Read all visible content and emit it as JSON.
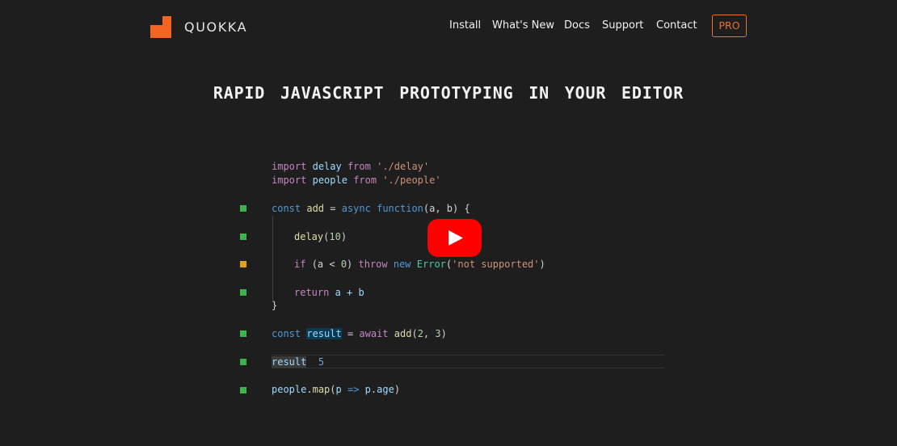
{
  "brand": {
    "name": "QUOKKA",
    "accent_color": "#f26522"
  },
  "nav": {
    "items": [
      {
        "label": "Install"
      },
      {
        "label": "What's New"
      },
      {
        "label": "Docs"
      },
      {
        "label": "Support"
      },
      {
        "label": "Contact"
      }
    ],
    "pro_label": "PRO",
    "pro_color": "#e8742a"
  },
  "hero": {
    "headline": "RAPID JAVASCRIPT PROTOTYPING IN YOUR EDITOR"
  },
  "code": {
    "line1": {
      "kw_import": "import",
      "name": "delay",
      "kw_from": "from",
      "path": "'./delay'"
    },
    "line2": {
      "kw_import": "import",
      "name": "people",
      "kw_from": "from",
      "path": "'./people'"
    },
    "line3": {
      "kw_const": "const",
      "name": "add",
      "eq": " = ",
      "kw_async": "async",
      "kw_function": "function",
      "params": "(a, b) {"
    },
    "line4": {
      "fn": "delay",
      "open": "(",
      "num": "10",
      "close": ")"
    },
    "line5": {
      "kw_if": "if",
      "cond": "(a < ",
      "num": "0",
      "close": ") ",
      "kw_throw": "throw",
      "kw_new": "new",
      "cls": "Error",
      "open": "(",
      "str": "'not supported'",
      "end": ")"
    },
    "line6": {
      "kw_return": "return",
      "expr": "a + b"
    },
    "line7": {
      "brace": "}"
    },
    "line8": {
      "kw_const": "const",
      "name": "result",
      "eq": " = ",
      "kw_await": "await",
      "fn": "add",
      "open": "(",
      "n1": "2",
      "sep": ", ",
      "n2": "3",
      "end": ")"
    },
    "line9": {
      "name": "result",
      "value": "5"
    },
    "line10": {
      "obj": "people",
      "dot": ".",
      "fn": "map",
      "open": "(",
      "p": "p",
      "arrow": "=>",
      "p2": "p",
      "dot2": ".",
      "prop": "age",
      "end": ")"
    }
  },
  "indicators": [
    {
      "line": 3,
      "status": "covered",
      "color": "#3cb44b"
    },
    {
      "line": 4,
      "status": "covered",
      "color": "#3cb44b"
    },
    {
      "line": 5,
      "status": "partial",
      "color": "#e0a019"
    },
    {
      "line": 6,
      "status": "covered",
      "color": "#3cb44b"
    },
    {
      "line": 8,
      "status": "covered",
      "color": "#3cb44b"
    },
    {
      "line": 9,
      "status": "covered",
      "color": "#3cb44b"
    },
    {
      "line": 10,
      "status": "covered",
      "color": "#3cb44b"
    }
  ],
  "video": {
    "icon": "youtube-play-icon",
    "color": "#ff0000"
  }
}
